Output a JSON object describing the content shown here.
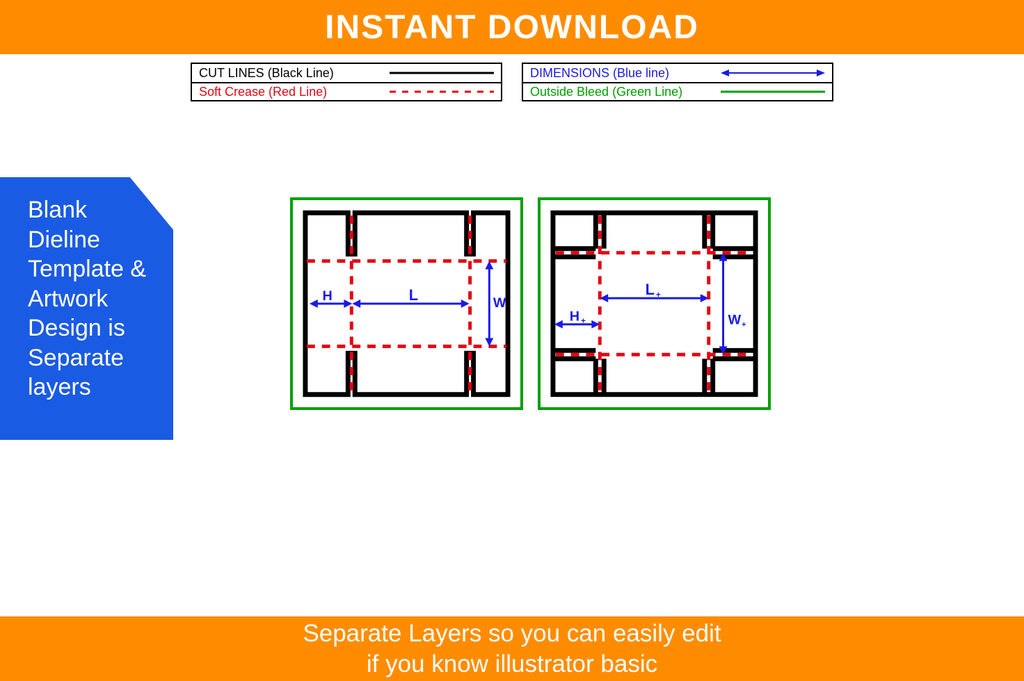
{
  "banner_top": "INSTANT DOWNLOAD",
  "legend": {
    "cut": "CUT LINES (Black Line)",
    "crease": "Soft Crease (Red Line)",
    "dim": "DIMENSIONS (Blue line)",
    "bleed": "Outside Bleed (Green Line)"
  },
  "side_badge": "Blank Dieline Template & Artwork Design is Separate layers",
  "dims": {
    "left": {
      "H": "H",
      "L": "L",
      "W": "W"
    },
    "right": {
      "H": "H",
      "L": "L",
      "W": "W"
    }
  },
  "banner_bottom_line1": "Separate Layers so you can easily edit",
  "banner_bottom_line2": "if you know illustrator basic",
  "colors": {
    "orange": "#ff8c00",
    "blue_badge": "#1a5be3",
    "green": "#00a000",
    "red": "#e30613",
    "blue_dim": "#1a1ae6"
  }
}
